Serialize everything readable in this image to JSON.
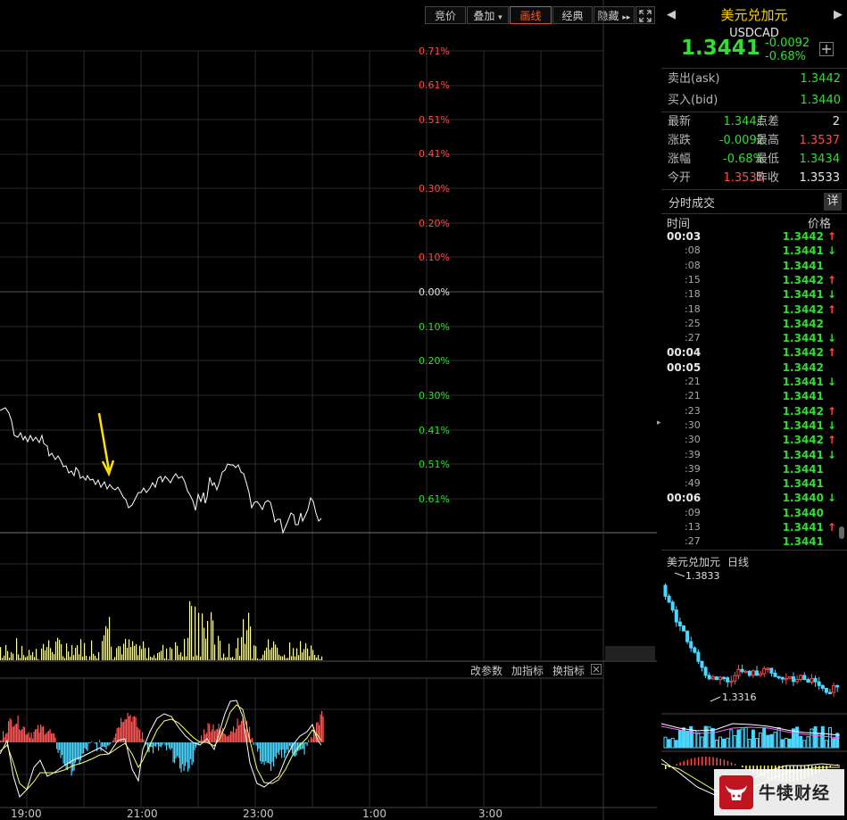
{
  "toolbar": {
    "buttons": [
      "竞价",
      "叠加",
      "画线",
      "经典",
      "隐藏"
    ],
    "overlay_arrow": "▾",
    "hide_arrow": "▸▸",
    "fullscreen_icon": "expand-icon"
  },
  "price_axis": [
    "0.71%",
    "0.61%",
    "0.51%",
    "0.41%",
    "0.30%",
    "0.20%",
    "0.10%",
    "0.00%",
    "0.10%",
    "0.20%",
    "0.30%",
    "0.41%",
    "0.51%",
    "0.61%"
  ],
  "time_axis": [
    "19:00",
    "21:00",
    "23:00",
    "1:00",
    "3:00"
  ],
  "indicator_links": [
    "改参数",
    "加指标",
    "换指标"
  ],
  "instrument": {
    "name": "美元兑加元",
    "code": "USDCAD",
    "price": "1.3441",
    "change": "-0.0092",
    "change_pct": "-0.68%",
    "add_icon": "plus-icon"
  },
  "quote": {
    "ask_label": "卖出(ask)",
    "ask": "1.3442",
    "bid_label": "买入(bid)",
    "bid": "1.3440"
  },
  "stats": {
    "latest_label": "最新",
    "latest": "1.3441",
    "spread_label": "点差",
    "spread": "2",
    "change_label": "涨跌",
    "change": "-0.0092",
    "high_label": "最高",
    "high": "1.3537",
    "change_pct_label": "涨幅",
    "change_pct": "-0.68%",
    "low_label": "最低",
    "low": "1.3434",
    "open_label": "今开",
    "open": "1.3535",
    "prev_close_label": "昨收",
    "prev_close": "1.3533"
  },
  "ticks": {
    "title": "分时成交",
    "detail_button": "详",
    "col_time": "时间",
    "col_price": "价格",
    "rows": [
      {
        "time": "00:03",
        "price": "1.3442",
        "dir": "up",
        "bold": true
      },
      {
        "time": ":08",
        "price": "1.3441",
        "dir": "down"
      },
      {
        "time": ":08",
        "price": "1.3441",
        "dir": ""
      },
      {
        "time": ":15",
        "price": "1.3442",
        "dir": "up"
      },
      {
        "time": ":18",
        "price": "1.3441",
        "dir": "down"
      },
      {
        "time": ":18",
        "price": "1.3442",
        "dir": "up"
      },
      {
        "time": ":25",
        "price": "1.3442",
        "dir": ""
      },
      {
        "time": ":27",
        "price": "1.3441",
        "dir": "down"
      },
      {
        "time": "00:04",
        "price": "1.3442",
        "dir": "up",
        "bold": true
      },
      {
        "time": "00:05",
        "price": "1.3442",
        "dir": "",
        "bold": true
      },
      {
        "time": ":21",
        "price": "1.3441",
        "dir": "down"
      },
      {
        "time": ":21",
        "price": "1.3441",
        "dir": ""
      },
      {
        "time": ":23",
        "price": "1.3442",
        "dir": "up"
      },
      {
        "time": ":30",
        "price": "1.3441",
        "dir": "down"
      },
      {
        "time": ":30",
        "price": "1.3442",
        "dir": "up"
      },
      {
        "time": ":39",
        "price": "1.3441",
        "dir": "down"
      },
      {
        "time": ":39",
        "price": "1.3441",
        "dir": ""
      },
      {
        "time": ":49",
        "price": "1.3441",
        "dir": ""
      },
      {
        "time": "00:06",
        "price": "1.3440",
        "dir": "down",
        "bold": true
      },
      {
        "time": ":09",
        "price": "1.3440",
        "dir": ""
      },
      {
        "time": ":13",
        "price": "1.3441",
        "dir": "up"
      },
      {
        "time": ":27",
        "price": "1.3441",
        "dir": ""
      }
    ]
  },
  "mini_chart": {
    "title": "美元兑加元",
    "period": "日线",
    "high_label": "1.3833",
    "low_label": "1.3316"
  },
  "watermark": {
    "text": "牛犊财经",
    "logo": "bull-logo-icon"
  },
  "colors": {
    "up": "#ff4a4a",
    "down": "#33dd33",
    "accent": "#ff5a2a",
    "volume": "#ffffaa",
    "macd_neg": "#4ad7ff"
  }
}
